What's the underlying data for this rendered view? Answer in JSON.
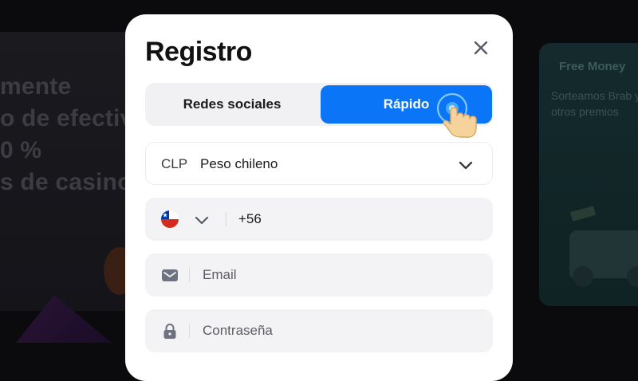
{
  "background": {
    "left_lines": [
      "mente",
      "o de efectiv",
      "0 %",
      "s de casino"
    ],
    "promo": {
      "title": "Free Money",
      "description": "Sorteamos Brab y otros premios"
    }
  },
  "modal": {
    "title": "Registro",
    "tabs": [
      {
        "label": "Redes sociales",
        "active": false
      },
      {
        "label": "Rápido",
        "active": true
      }
    ],
    "currency": {
      "code": "CLP",
      "name": "Peso chileno"
    },
    "phone": {
      "prefix": "+56",
      "country_flag": "chile-flag-icon"
    },
    "email": {
      "placeholder": "Email",
      "value": ""
    },
    "password": {
      "placeholder": "Contraseña",
      "value": ""
    }
  },
  "colors": {
    "accent": "#0a75f6",
    "field_bg": "#f3f3f5",
    "tab_bg": "#f1f1f3",
    "backdrop": "#0b0b0d"
  }
}
